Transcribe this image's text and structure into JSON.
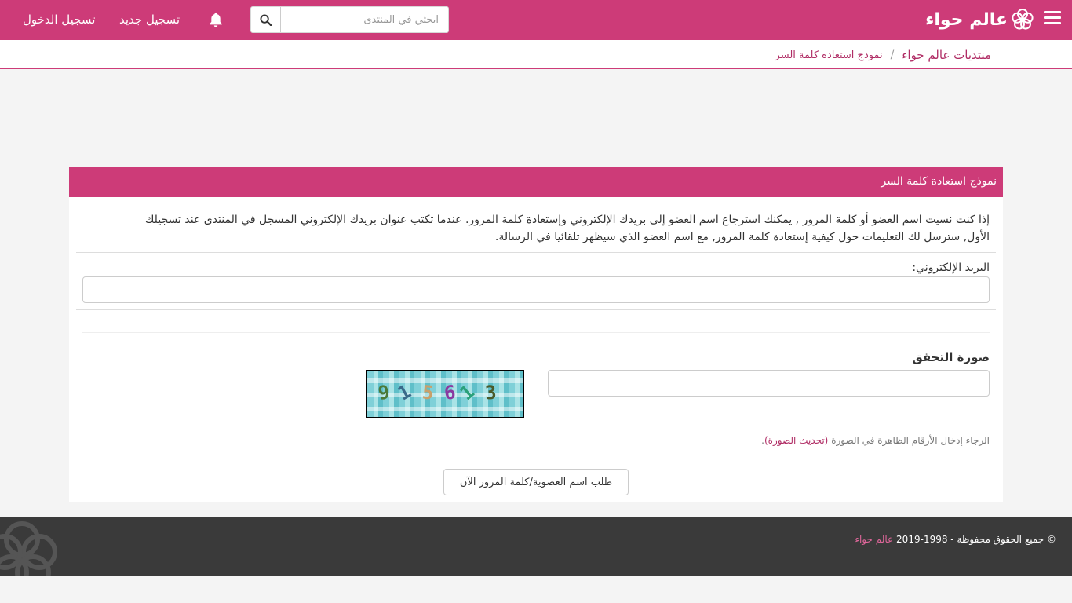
{
  "header": {
    "logo_text": "عالم حواء",
    "search_placeholder": "ابحثي في المنتدى",
    "register_label": "تسجيل جديد",
    "login_label": "تسجيل الدخول"
  },
  "breadcrumb": {
    "home": "منتديات عالم حواء",
    "separator": "/",
    "current": "نموذج استعادة كلمة السر"
  },
  "panel": {
    "title": "نموذج استعادة كلمة السر",
    "intro": "إذا كنت نسيت اسم العضو أو كلمة المرور , يمكنك استرجاع اسم العضو إلى بريدك الإلكتروني وإستعادة كلمة المرور. عندما تكتب عنوان بريدك الإلكتروني المسجل في المنتدى عند تسجيلك الأول, سترسل لك التعليمات حول كيفية إستعادة كلمة المرور, مع اسم العضو الذي سيظهر تلقائيا في الرسالة.",
    "email_label": "البريد الإلكتروني:",
    "email_value": "",
    "captcha_label": "صورة التحقق",
    "captcha_value": "",
    "captcha_image_digits": [
      "9",
      "1",
      "5",
      "6",
      "1",
      "3"
    ],
    "captcha_hint": "الرجاء إدخال الأرقام الظاهرة في الصورة",
    "captcha_refresh": "(تحديث الصورة)",
    "captcha_hint_end": ".",
    "submit_label": "طلب اسم العضوية/كلمة المرور الآن"
  },
  "footer": {
    "copyright": "© جميع الحقوق محفوظة - 1998-2019",
    "brand": "عالم حواء"
  },
  "colors": {
    "brand": "#cd3b78",
    "link": "#b02d65",
    "footer_bg": "#3a3a3a"
  },
  "icons": [
    "menu-icon",
    "logo-flower-icon",
    "search-icon",
    "bell-icon",
    "footer-flower-icon"
  ]
}
